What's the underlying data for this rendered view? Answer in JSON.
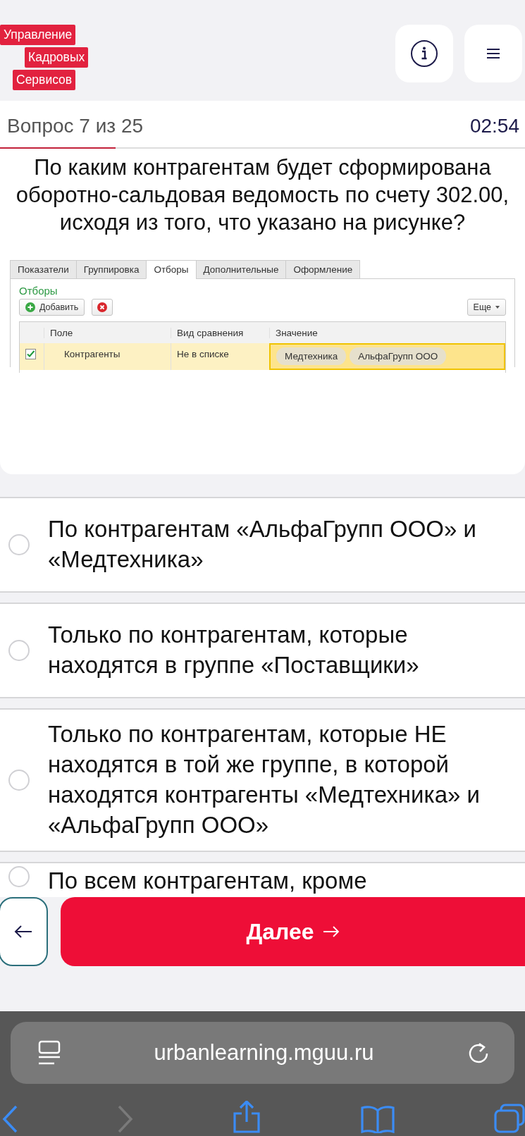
{
  "header": {
    "logo": [
      "Управление",
      "Кадровых",
      "Сервисов"
    ]
  },
  "quiz": {
    "counter": "Вопрос 7 из 25",
    "timer": "02:54",
    "progress": {
      "level": 0.22
    },
    "question": "По каким контрагентам будет сформирована оборотно-сальдовая ведомость по счету 302.00, исходя из того, что указано на рисунке?",
    "figure": {
      "tabs": [
        {
          "label": "Показатели",
          "selected": false
        },
        {
          "label": "Группировка",
          "selected": false
        },
        {
          "label": "Отборы",
          "selected": true
        },
        {
          "label": "Дополнительные",
          "selected": false
        },
        {
          "label": "Оформление",
          "selected": false
        }
      ],
      "section_title": "Отборы",
      "add_button": "Добавить",
      "more_button": "Еще",
      "columns": [
        "Поле",
        "Вид сравнения",
        "Значение"
      ],
      "rows": [
        {
          "checked": true,
          "field": "Контрагенты",
          "comparison": "Не в списке",
          "values": [
            "Медтехника",
            "АльфаГрупп ООО"
          ]
        }
      ]
    }
  },
  "options": [
    {
      "text": "По контрагентам «АльфаГрупп ООО» и «Медтехника»",
      "selected": false
    },
    {
      "text": "Только по контрагентам, которые находятся в группе «Поставщики»",
      "selected": false
    },
    {
      "text": "Только по контрагентам, которые НЕ находятся в той же группе, в которой находятся контрагенты «Медтехника» и «АльфаГрупп ООО»",
      "selected": false
    },
    {
      "text": "По всем контрагентам, кроме",
      "selected": false
    }
  ],
  "navigation": {
    "next_button": "Далее"
  },
  "browser": {
    "url": "urbanlearning.mguu.ru"
  }
}
